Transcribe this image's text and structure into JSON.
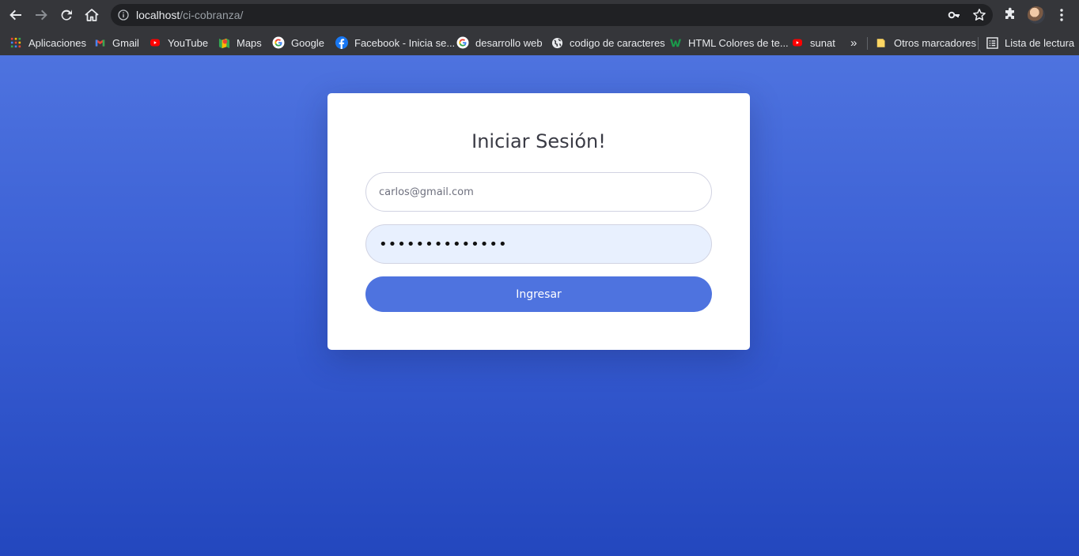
{
  "browser": {
    "url_host": "localhost",
    "url_path": "/ci-cobranza/",
    "icons": [
      "back-icon",
      "forward-icon",
      "reload-icon",
      "home-icon",
      "info-icon",
      "key-icon",
      "star-icon",
      "extensions-icon",
      "avatar",
      "menu-icon"
    ]
  },
  "bookmarks": {
    "items": [
      {
        "label": "Aplicaciones",
        "icon": "apps-grid-icon"
      },
      {
        "label": "Gmail",
        "icon": "gmail-icon"
      },
      {
        "label": "YouTube",
        "icon": "youtube-icon"
      },
      {
        "label": "Maps",
        "icon": "maps-icon"
      },
      {
        "label": "Google",
        "icon": "google-icon"
      },
      {
        "label": "Facebook - Inicia se...",
        "icon": "facebook-icon"
      },
      {
        "label": "desarrollo web",
        "icon": "google-icon"
      },
      {
        "label": "codigo de caracteres",
        "icon": "globe-icon"
      },
      {
        "label": "HTML Colores de te...",
        "icon": "w-icon"
      },
      {
        "label": "sunat",
        "icon": "youtube-icon"
      }
    ],
    "overflow": "»",
    "other": "Otros marcadores",
    "reading_list": "Lista de lectura"
  },
  "login": {
    "title": "Iniciar Sesión!",
    "email_placeholder": "carlos@gmail.com",
    "password_value": "••••••••••••••",
    "submit_label": "Ingresar"
  },
  "colors": {
    "primary": "#4e73df",
    "chrome_dark": "#35363a",
    "omnibox": "#202124",
    "autofill": "#e8f0fe"
  }
}
